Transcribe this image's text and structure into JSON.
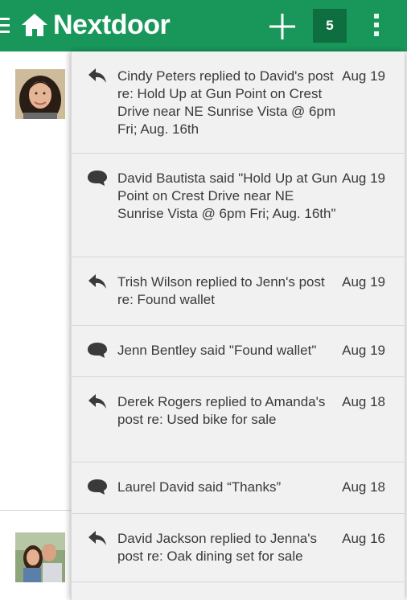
{
  "app": {
    "brand": "Nextdoor",
    "notification_count": "5",
    "colors": {
      "brand_green": "#19975a",
      "badge_bg": "#0f6e40",
      "panel_bg": "#f1f1f1"
    }
  },
  "icons": {
    "menu": "hamburger-icon",
    "logo": "house-icon",
    "add": "plus-icon",
    "overflow": "vertical-dots-icon",
    "reply": "reply-arrow-icon",
    "comment": "speech-bubble-icon"
  },
  "notifications": [
    {
      "type": "reply",
      "text": "Cindy Peters replied to David's post re: Hold Up at Gun Point on Crest Drive near NE Sunrise Vista @ 6pm Fri; Aug. 16th",
      "date": "Aug 19"
    },
    {
      "type": "comment",
      "text": "David Bautista said \"Hold Up at Gun Point on Crest Drive near NE Sunrise Vista @ 6pm Fri; Aug. 16th\"",
      "date": "Aug 19"
    },
    {
      "type": "reply",
      "text": "Trish Wilson replied to Jenn's post re: Found wallet",
      "date": "Aug 19"
    },
    {
      "type": "comment",
      "text": "Jenn Bentley said \"Found wallet\"",
      "date": "Aug 19"
    },
    {
      "type": "reply",
      "text": "Derek Rogers replied to Amanda's post re: Used bike for sale",
      "date": "Aug 18"
    },
    {
      "type": "comment",
      "text": "Laurel David said “Thanks”",
      "date": "Aug 18"
    },
    {
      "type": "reply",
      "text": "David Jackson replied to Jenna's post re: Oak dining set for sale",
      "date": "Aug 16"
    }
  ]
}
